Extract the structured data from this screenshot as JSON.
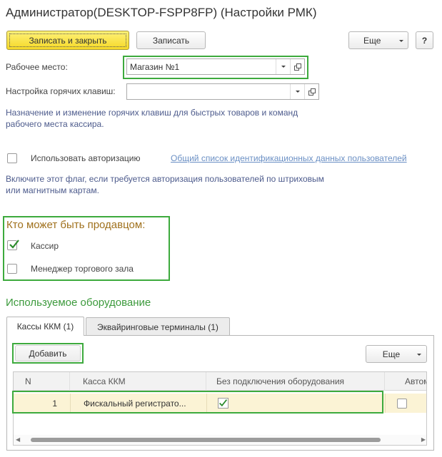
{
  "window": {
    "title": "Администратор(DESKTOP-FSPP8FP) (Настройки РМК)"
  },
  "toolbar": {
    "save_close_label": "Записать и закрыть",
    "save_label": "Записать",
    "more_label": "Еще",
    "help_label": "?"
  },
  "form": {
    "workplace_label": "Рабочее место:",
    "workplace_value": "Магазин №1",
    "hotkeys_label": "Настройка горячих клавиш:",
    "hotkeys_value": "",
    "hotkeys_hint_line1": "Назначение и изменение горячих клавиш для быстрых товаров и команд",
    "hotkeys_hint_line2": "рабочего места кассира.",
    "use_auth_label": "Использовать авторизацию",
    "use_auth_checked": false,
    "auth_link": "Общий список идентификационных данных пользователей",
    "auth_hint_line1": "Включите этот флаг, если требуется авторизация пользователей по штриховым",
    "auth_hint_line2": "или магнитным картам."
  },
  "seller": {
    "title": "Кто может быть продавцом:",
    "cashier_label": "Кассир",
    "cashier_checked": true,
    "manager_label": "Менеджер торгового зала",
    "manager_checked": false
  },
  "equipment": {
    "title": "Используемое оборудование",
    "tabs": [
      {
        "label": "Кассы ККМ (1)",
        "active": true
      },
      {
        "label": "Эквайринговые терминалы (1)",
        "active": false
      }
    ],
    "add_label": "Добавить",
    "more_label": "Еще",
    "table": {
      "columns": [
        "N",
        "Касса ККМ",
        "Без подключения оборудования",
        "Автома"
      ],
      "rows": [
        {
          "n": "1",
          "kassa": "Фискальный регистрато...",
          "no_connection": true,
          "auto": false
        }
      ]
    }
  },
  "colors": {
    "accent_green": "#3daa3d",
    "seller_title": "#a0711d",
    "equipment_title": "#3c9a3c",
    "hint_text": "#4d5b8c",
    "link": "#6a8fc4",
    "row_highlight": "#fbf3d5"
  }
}
